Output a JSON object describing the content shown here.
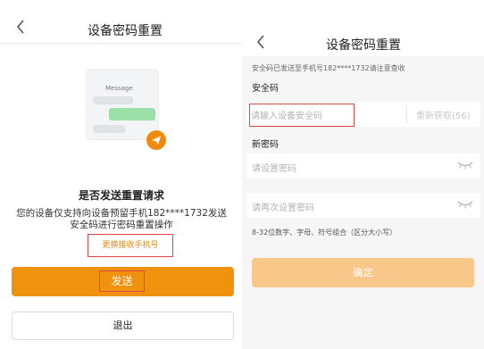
{
  "left_panel": {
    "back_icon": "chevron-left-icon",
    "title": "设备密码重置",
    "illustration": {
      "message_label": "Message",
      "badge_icon": "send-plane-icon"
    },
    "question": "是否发送重置请求",
    "description_line1": "您的设备仅支持向设备预留手机182****1732发送",
    "description_line2": "安全码进行密码重置操作",
    "change_phone_link": "更换接收手机号",
    "send_button": "发送",
    "exit_button": "退出"
  },
  "right_panel": {
    "back_icon": "chevron-left-icon",
    "title": "设备密码重置",
    "sent_notice": "安全码已发送至手机号182****1732请注意查收",
    "security_code": {
      "label": "安全码",
      "placeholder": "请输入设备安全码",
      "resend_label": "重新获取(56)"
    },
    "new_password": {
      "label": "新密码",
      "placeholder": "请设置密码",
      "confirm_placeholder": "请再次设置密码",
      "eye_icon": "eye-closed-icon"
    },
    "password_hint": "8-32位数字、字母、符号组合（区分大小写）",
    "confirm_button": "确定"
  },
  "colors": {
    "accent": "#f0920e",
    "accent_disabled": "#f9c78a",
    "highlight_border": "#e04848",
    "panel_bg": "#f6f6f6"
  }
}
